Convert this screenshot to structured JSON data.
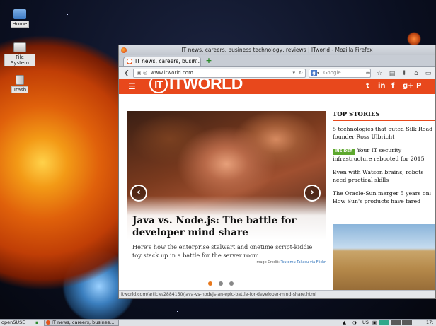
{
  "desktop": {
    "icons": [
      {
        "label": "Home"
      },
      {
        "label": "File System"
      },
      {
        "label": "Trash"
      }
    ]
  },
  "window": {
    "title": "IT news, careers, business technology, reviews | ITworld - Mozilla Firefox",
    "tab_title": "IT news, careers, busin...",
    "url": "www.itworld.com",
    "search_placeholder": "Google",
    "status_url": "itworld.com/article/2884150/java-vs-nodejs-an-epic-battle-for-developer-mind-share.html"
  },
  "page": {
    "logo": "ITWORLD",
    "logo_ring": "IT",
    "social": [
      "t",
      "in",
      "f",
      "g+",
      "P"
    ],
    "hero": {
      "headline": "Java vs. Node.js: The battle for developer mind share",
      "dek": "Here's how the enterprise stalwart and onetime script-kiddie toy stack up in a battle for the server room.",
      "credit_prefix": "Image Credit:",
      "credit_name": "Tsutomu Takasu via Flickr"
    },
    "top_stories": {
      "heading": "TOP STORIES",
      "items": [
        {
          "badge": "",
          "text": "5 technologies that outed Silk Road founder Ross Ulbricht"
        },
        {
          "badge": "INSIDER",
          "text": "Your IT security infrastructure rebooted for 2015"
        },
        {
          "badge": "",
          "text": "Even with Watson brains, robots need practical skills"
        },
        {
          "badge": "",
          "text": "The Oracle-Sun merger 5 years on: How Sun's products have fared"
        }
      ]
    }
  },
  "taskbar": {
    "start": "openSUSE",
    "task": "IT news, careers, busines...",
    "lang": "US",
    "clock": "17:"
  }
}
